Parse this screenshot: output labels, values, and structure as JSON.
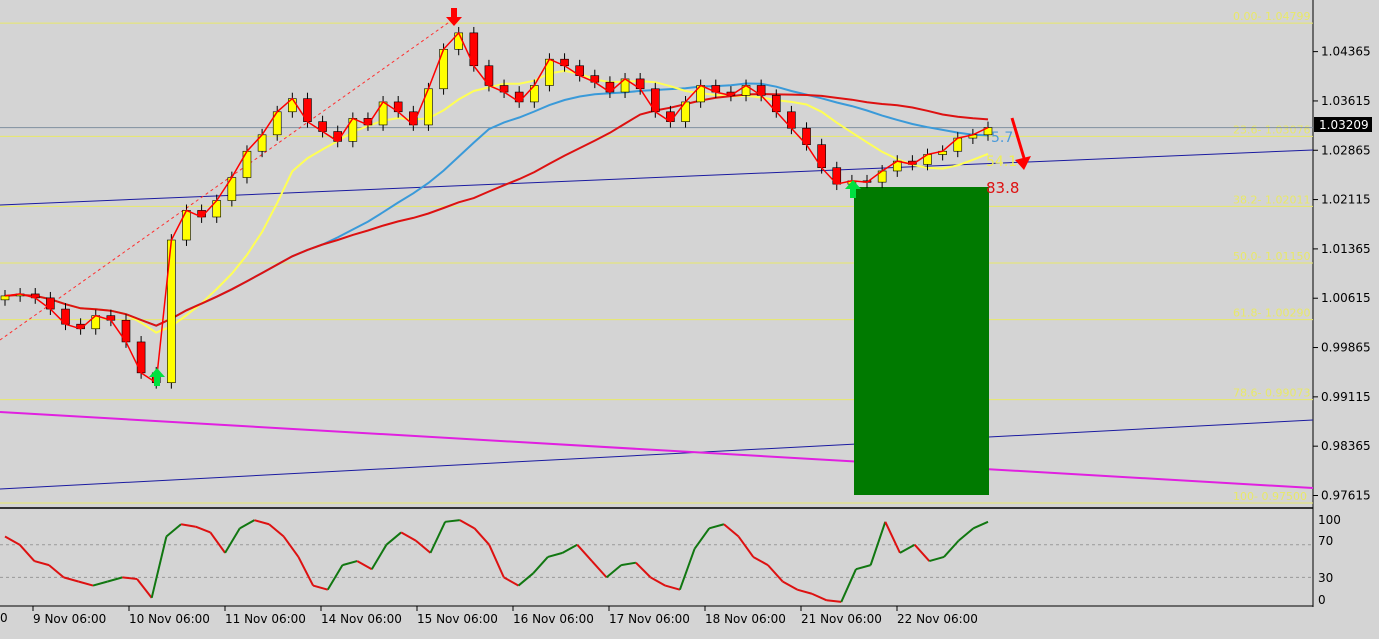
{
  "chart_data": [
    {
      "type": "candlestick",
      "panel": "price",
      "current_price": "1.03209",
      "y_ticks": [
        "1.04365",
        "1.03615",
        "1.02865",
        "1.02115",
        "1.01365",
        "1.00615",
        "0.99865",
        "0.99115",
        "0.98365",
        "0.97615"
      ],
      "ylim": [
        0.9744,
        1.0515
      ],
      "x_labels": [
        "9 Nov 06:00",
        "10 Nov 06:00",
        "11 Nov 06:00",
        "14 Nov 06:00",
        "15 Nov 06:00",
        "16 Nov 06:00",
        "17 Nov 06:00",
        "18 Nov 06:00",
        "21 Nov 06:00",
        "22 Nov 06:00"
      ],
      "partial_tick_label": "0",
      "fib_levels": [
        {
          "label": "0.00- 1.04799",
          "value": 1.04799
        },
        {
          "label": "23.6- 1.03076",
          "value": 1.03076
        },
        {
          "label": "38.2- 1.02011",
          "value": 1.02011
        },
        {
          "label": "50.0- 1.01150",
          "value": 1.0115
        },
        {
          "label": "61.8- 1.00290",
          "value": 1.0029
        },
        {
          "label": "78.6- 0.99073",
          "value": 0.99073
        },
        {
          "label": "100- 0.97500",
          "value": 0.975
        }
      ],
      "close_series": [
        1.0065,
        1.0068,
        1.0062,
        1.0045,
        1.0022,
        1.0015,
        1.0035,
        1.0028,
        0.9995,
        0.9948,
        0.9933,
        1.015,
        1.0195,
        1.0185,
        1.021,
        1.0245,
        1.0285,
        1.031,
        1.0345,
        1.0365,
        1.033,
        1.0315,
        1.03,
        1.0335,
        1.0325,
        1.036,
        1.0345,
        1.0325,
        1.038,
        1.044,
        1.0465,
        1.0415,
        1.0385,
        1.0375,
        1.036,
        1.0385,
        1.0425,
        1.0415,
        1.04,
        1.039,
        1.0375,
        1.0395,
        1.038,
        1.0345,
        1.033,
        1.036,
        1.0385,
        1.0375,
        1.037,
        1.0385,
        1.037,
        1.0345,
        1.032,
        1.0295,
        1.026,
        1.0235,
        1.024,
        1.0238,
        1.0255,
        1.027,
        1.0265,
        1.028,
        1.0285,
        1.0305,
        1.031,
        1.0321
      ],
      "indicator_values": {
        "blue": "5.7",
        "yellow": "54.1",
        "red": "83.8"
      },
      "colors": {
        "background": "#d4d4d4",
        "bull_candle": "#ffff00",
        "bear_candle": "#ff0000",
        "ma_blue": "#3a9ad9",
        "ma_yellow": "#ffff55",
        "ma_red": "#dd1111",
        "fib_line": "#e8e86a",
        "trendline": "#1a1aa0",
        "magenta_line": "#e020e0",
        "target_box": "#007a00",
        "arrow_up": "#00e040",
        "arrow_down": "#ff0000"
      }
    },
    {
      "type": "line",
      "panel": "oscillator",
      "y_ticks": [
        "100",
        "70",
        "30",
        "0"
      ],
      "ylim": [
        -5,
        110
      ],
      "values": [
        80,
        70,
        50,
        45,
        30,
        25,
        20,
        25,
        30,
        28,
        5,
        80,
        95,
        92,
        85,
        60,
        90,
        100,
        95,
        80,
        55,
        20,
        15,
        45,
        50,
        40,
        70,
        85,
        75,
        60,
        98,
        100,
        90,
        70,
        30,
        20,
        35,
        55,
        60,
        70,
        50,
        30,
        45,
        48,
        30,
        20,
        15,
        65,
        90,
        95,
        80,
        55,
        45,
        25,
        15,
        10,
        2,
        0,
        40,
        45,
        98,
        60,
        70,
        50,
        55,
        75,
        90,
        98
      ]
    }
  ]
}
